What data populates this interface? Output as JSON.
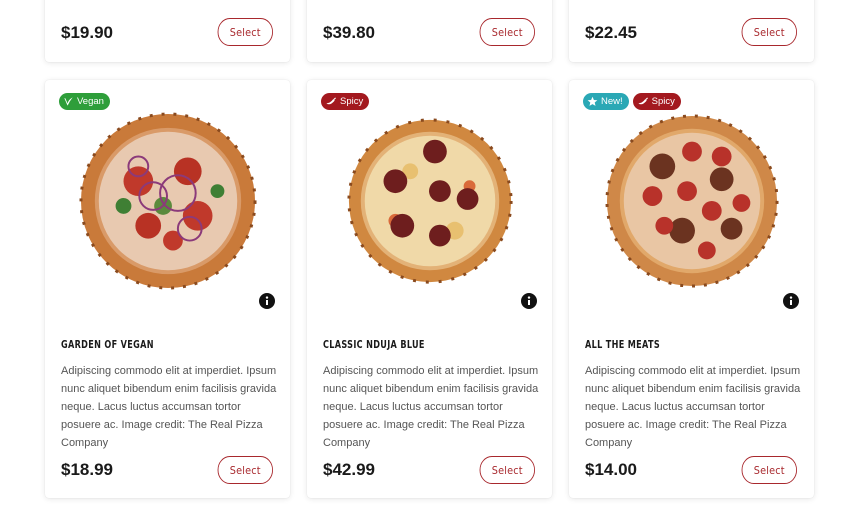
{
  "colors": {
    "accent": "#a8282d",
    "vegan_badge": "#2e9e3a",
    "spicy_badge": "#a3191f",
    "new_badge": "#2aa8b5"
  },
  "top_row": [
    {
      "price": "$19.90",
      "select_label": "Select"
    },
    {
      "price": "$39.80",
      "select_label": "Select"
    },
    {
      "price": "$22.45",
      "select_label": "Select"
    }
  ],
  "products": [
    {
      "badges": [
        {
          "label": "Vegan",
          "icon": "leaf-icon"
        }
      ],
      "title": "GARDEN OF VEGAN",
      "description": "Adipiscing commodo elit at imperdiet. Ipsum nunc aliquet bibendum enim facilisis gravida neque. Lacus luctus accumsan tortor posuere ac. Image credit: The Real Pizza Company",
      "price": "$18.99",
      "select_label": "Select"
    },
    {
      "badges": [
        {
          "label": "Spicy",
          "icon": "chili-icon"
        }
      ],
      "title": "CLASSIC NDUJA BLUE",
      "description": "Adipiscing commodo elit at imperdiet. Ipsum nunc aliquet bibendum enim facilisis gravida neque. Lacus luctus accumsan tortor posuere ac. Image credit: The Real Pizza Company",
      "price": "$42.99",
      "select_label": "Select"
    },
    {
      "badges": [
        {
          "label": "New!",
          "icon": "star-icon"
        },
        {
          "label": "Spicy",
          "icon": "chili-icon"
        }
      ],
      "title": "ALL THE MEATS",
      "description": "Adipiscing commodo elit at imperdiet. Ipsum nunc aliquet bibendum enim facilisis gravida neque. Lacus luctus accumsan tortor posuere ac. Image credit: The Real Pizza Company",
      "price": "$14.00",
      "select_label": "Select"
    }
  ]
}
